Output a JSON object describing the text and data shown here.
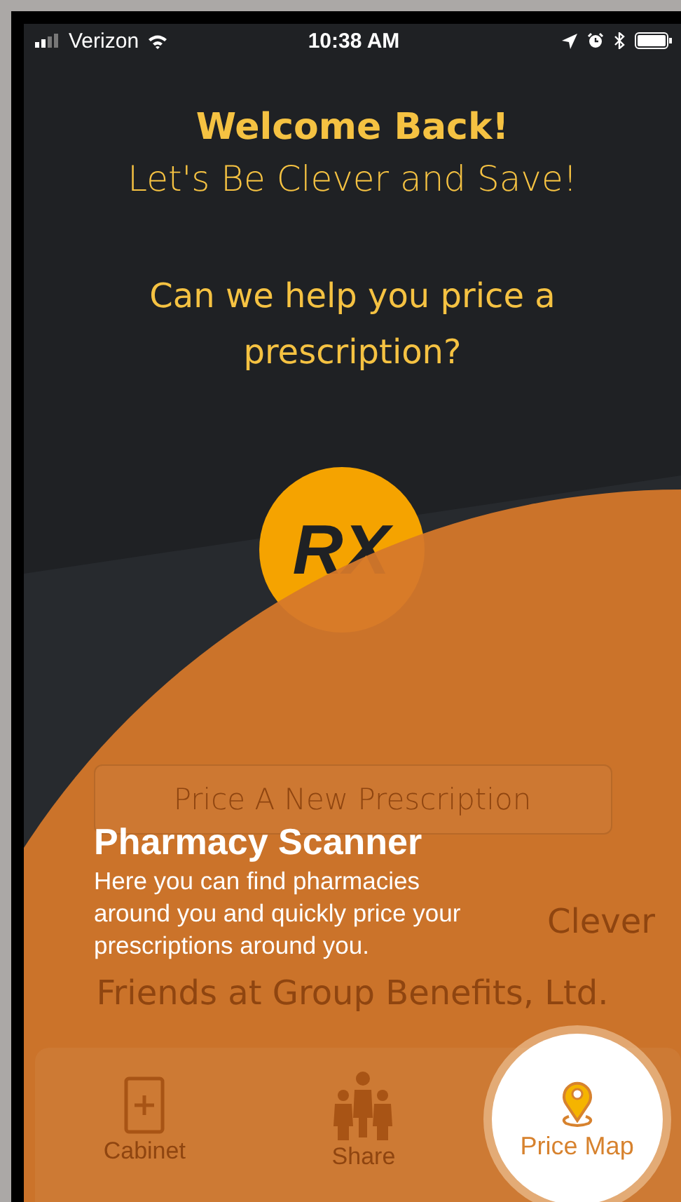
{
  "status_bar": {
    "carrier": "Verizon",
    "time": "10:38 AM"
  },
  "header": {
    "title": "Welcome Back!",
    "subtitle": "Let's Be Clever and Save!"
  },
  "prompt": "Can we help you price a prescription?",
  "logo": {
    "text": "RX"
  },
  "primary_button": {
    "label": "Price A New Prescription"
  },
  "footer_lines": [
    "Clever",
    "Friends at Group Benefits, Ltd."
  ],
  "coach_mark": {
    "title": "Pharmacy Scanner",
    "body": "Here you can find pharmacies around you and quickly price your prescriptions around you."
  },
  "tabs": [
    {
      "label": "Cabinet",
      "selected": false,
      "kind": "cabinet"
    },
    {
      "label": "Share",
      "selected": false,
      "kind": "share"
    },
    {
      "label": "Price Map",
      "selected": true,
      "kind": "map"
    }
  ]
}
